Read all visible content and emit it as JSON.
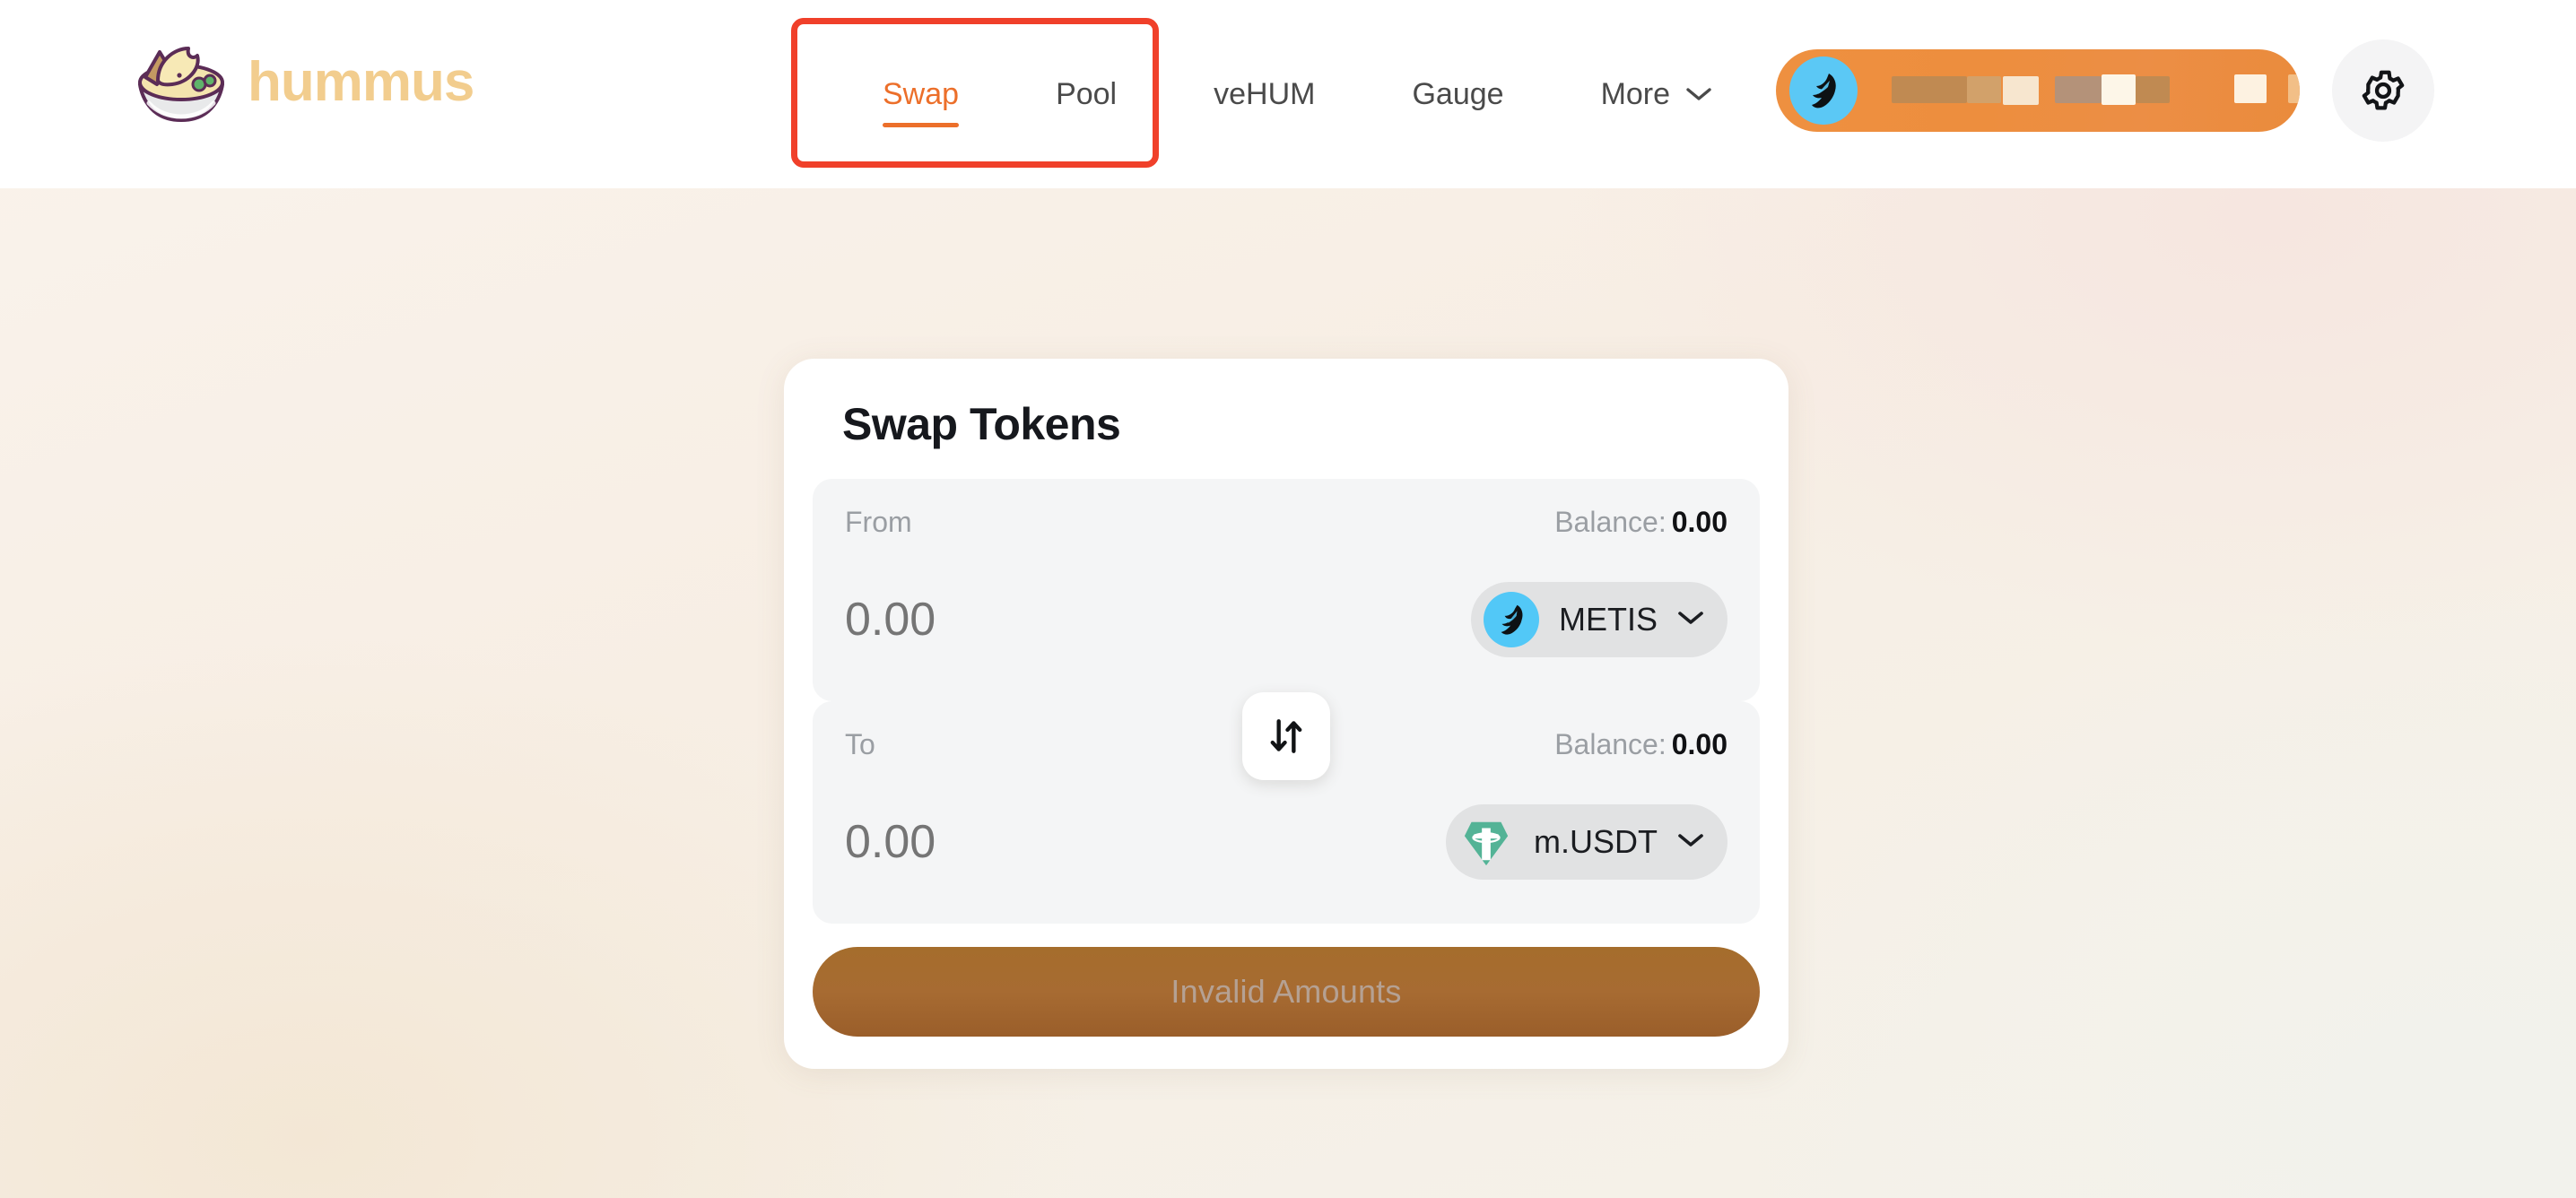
{
  "header": {
    "logo_text": "hummus",
    "logo_icon": "hummus-bowl-icon",
    "nav": [
      {
        "label": "Swap",
        "active": true,
        "has_chevron": false
      },
      {
        "label": "Pool",
        "active": false,
        "has_chevron": false
      },
      {
        "label": "veHUM",
        "active": false,
        "has_chevron": false
      },
      {
        "label": "Gauge",
        "active": false,
        "has_chevron": false
      },
      {
        "label": "More",
        "active": false,
        "has_chevron": true
      }
    ],
    "wallet": {
      "chain_icon": "metis-icon",
      "address_text": "",
      "redacted": true
    },
    "settings_icon": "gear-icon"
  },
  "annotation": {
    "color": "#f0402a"
  },
  "swap": {
    "title": "Swap Tokens",
    "from": {
      "label": "From",
      "balance_label": "Balance:",
      "balance_value": "0.00",
      "amount": "0.00",
      "token": "METIS",
      "token_icon": "metis-icon"
    },
    "to": {
      "label": "To",
      "balance_label": "Balance:",
      "balance_value": "0.00",
      "amount": "0.00",
      "token": "m.USDT",
      "token_icon": "tether-icon"
    },
    "swap_direction_icon": "swap-vertical-icon",
    "cta_label": "Invalid Amounts"
  },
  "colors": {
    "accent": "#ec6f2a",
    "wallet_pill": "#ee9040",
    "cta_disabled": "#a56d2c",
    "logo": "#f2cd8e",
    "annotation": "#f0402a"
  }
}
